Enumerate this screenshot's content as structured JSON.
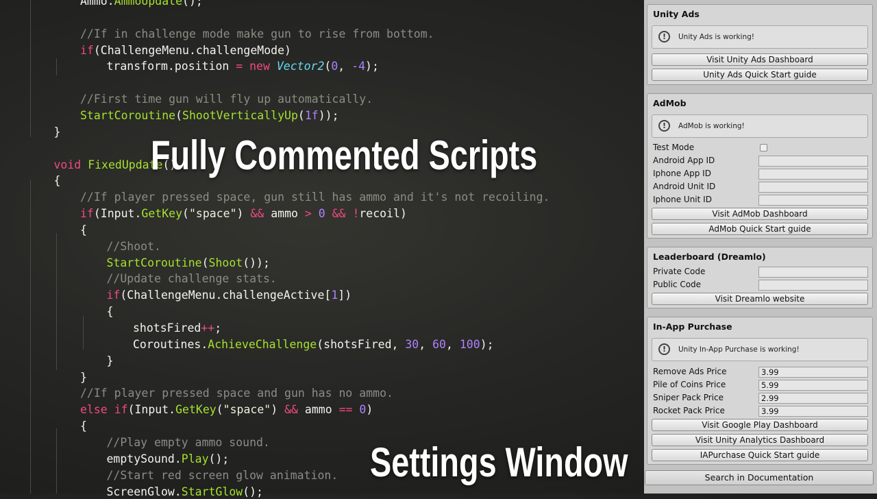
{
  "code_lines": [
    [
      [
        "",
        "Ammo."
      ],
      [
        "t-fn",
        "AmmoUpdate"
      ],
      [
        "",
        "();"
      ]
    ],
    [],
    [
      [
        "t-com",
        "//If in challenge mode make gun to rise from bottom."
      ]
    ],
    [
      [
        "t-kw",
        "if"
      ],
      [
        "",
        "(ChallengeMenu.challengeMode)"
      ]
    ],
    [
      [
        "",
        "transform.position "
      ],
      [
        "t-op",
        "="
      ],
      [
        "",
        " "
      ],
      [
        "t-kw",
        "new"
      ],
      [
        "",
        " "
      ],
      [
        "t-type",
        "Vector2"
      ],
      [
        "",
        "("
      ],
      [
        "t-num",
        "0"
      ],
      [
        "",
        ", "
      ],
      [
        "t-num",
        "-4"
      ],
      [
        "",
        ");"
      ]
    ],
    [],
    [
      [
        "t-com",
        "//First time gun will fly up automatically."
      ]
    ],
    [
      [
        "t-fn",
        "StartCoroutine"
      ],
      [
        "",
        "("
      ],
      [
        "t-fn",
        "ShootVerticallyUp"
      ],
      [
        "",
        "("
      ],
      [
        "t-num",
        "1f"
      ],
      [
        "",
        "));"
      ]
    ],
    [
      [
        "",
        "}"
      ]
    ],
    [],
    [
      [
        "t-kw",
        "void"
      ],
      [
        "",
        " "
      ],
      [
        "t-fn",
        "FixedUpdate"
      ],
      [
        "",
        "()"
      ]
    ],
    [
      [
        "",
        "{"
      ]
    ],
    [
      [
        "t-com",
        "//If player pressed space, gun still has ammo and it's not recoiling."
      ]
    ],
    [
      [
        "t-kw",
        "if"
      ],
      [
        "",
        "(Input."
      ],
      [
        "t-fn",
        "GetKey"
      ],
      [
        "",
        "("
      ],
      [
        "t-str",
        "\"space\""
      ],
      [
        "",
        ") "
      ],
      [
        "t-op",
        "&&"
      ],
      [
        "",
        " ammo "
      ],
      [
        "t-op",
        ">"
      ],
      [
        "",
        " "
      ],
      [
        "t-num",
        "0"
      ],
      [
        "",
        " "
      ],
      [
        "t-op",
        "&&"
      ],
      [
        "",
        " "
      ],
      [
        "t-op",
        "!"
      ],
      [
        "",
        "recoil)"
      ]
    ],
    [
      [
        "",
        "{"
      ]
    ],
    [
      [
        "t-com",
        "//Shoot."
      ]
    ],
    [
      [
        "t-fn",
        "StartCoroutine"
      ],
      [
        "",
        "("
      ],
      [
        "t-fn",
        "Shoot"
      ],
      [
        "",
        "());"
      ]
    ],
    [
      [
        "t-com",
        "//Update challenge stats."
      ]
    ],
    [
      [
        "t-kw",
        "if"
      ],
      [
        "",
        "(ChallengeMenu.challengeActive["
      ],
      [
        "t-num",
        "1"
      ],
      [
        "",
        "])"
      ]
    ],
    [
      [
        "",
        "{"
      ]
    ],
    [
      [
        "",
        "shotsFired"
      ],
      [
        "t-op",
        "++"
      ],
      [
        "",
        ";"
      ]
    ],
    [
      [
        "",
        "Coroutines."
      ],
      [
        "t-fn",
        "AchieveChallenge"
      ],
      [
        "",
        "(shotsFired, "
      ],
      [
        "t-num",
        "30"
      ],
      [
        "",
        ", "
      ],
      [
        "t-num",
        "60"
      ],
      [
        "",
        ", "
      ],
      [
        "t-num",
        "100"
      ],
      [
        "",
        ");"
      ]
    ],
    [
      [
        "",
        "}"
      ]
    ],
    [
      [
        "",
        "}"
      ]
    ],
    [
      [
        "t-com",
        "//If player pressed space and gun has no ammo."
      ]
    ],
    [
      [
        "t-kw",
        "else"
      ],
      [
        "",
        " "
      ],
      [
        "t-kw",
        "if"
      ],
      [
        "",
        "(Input."
      ],
      [
        "t-fn",
        "GetKey"
      ],
      [
        "",
        "("
      ],
      [
        "t-str",
        "\"space\""
      ],
      [
        "",
        ") "
      ],
      [
        "t-op",
        "&&"
      ],
      [
        "",
        " ammo "
      ],
      [
        "t-op",
        "=="
      ],
      [
        "",
        " "
      ],
      [
        "t-num",
        "0"
      ],
      [
        "",
        ")"
      ]
    ],
    [
      [
        "",
        "{"
      ]
    ],
    [
      [
        "t-com",
        "//Play empty ammo sound."
      ]
    ],
    [
      [
        "",
        "emptySound."
      ],
      [
        "t-fn",
        "Play"
      ],
      [
        "",
        "();"
      ]
    ],
    [
      [
        "t-com",
        "//Start red screen glow animation."
      ]
    ],
    [
      [
        "",
        "ScreenGlow."
      ],
      [
        "t-fn",
        "StartGlow"
      ],
      [
        "",
        "();"
      ]
    ]
  ],
  "titles": {
    "main": "Fully Commented Scripts",
    "sub": "Settings Window"
  },
  "unity_ads": {
    "title": "Unity Ads",
    "help": "Unity Ads is working!",
    "dashboard_button": "Visit Unity Ads Dashboard",
    "guide_button": "Unity Ads Quick Start guide"
  },
  "admob": {
    "title": "AdMob",
    "help": "AdMob is working!",
    "test_mode_label": "Test Mode",
    "test_mode_checked": false,
    "fields": [
      {
        "label": "Android App ID",
        "value": ""
      },
      {
        "label": "Iphone App ID",
        "value": ""
      },
      {
        "label": "Android Unit ID",
        "value": ""
      },
      {
        "label": "Iphone Unit ID",
        "value": ""
      }
    ],
    "dashboard_button": "Visit AdMob Dashboard",
    "guide_button": "AdMob Quick Start guide"
  },
  "leaderboard": {
    "title": "Leaderboard (Dreamlo)",
    "fields": [
      {
        "label": "Private Code",
        "value": ""
      },
      {
        "label": "Public Code",
        "value": ""
      }
    ],
    "website_button": "Visit Dreamlo website"
  },
  "iap": {
    "title": "In-App Purchase",
    "help": "Unity In-App Purchase is working!",
    "fields": [
      {
        "label": "Remove Ads Price",
        "value": "3.99"
      },
      {
        "label": "Pile of Coins Price",
        "value": "5.99"
      },
      {
        "label": "Sniper Pack Price",
        "value": "2.99"
      },
      {
        "label": "Rocket Pack Price",
        "value": "3.99"
      }
    ],
    "play_button": "Visit Google Play Dashboard",
    "analytics_button": "Visit Unity Analytics Dashboard",
    "guide_button": "IAPurchase Quick Start guide"
  },
  "search_button": "Search in Documentation",
  "colors": {
    "comment": "#8d8d86",
    "keyword": "#f04a83",
    "function": "#a6e22e",
    "number": "#ae81ff",
    "type": "#66d9ef",
    "panel_bg": "#c2c2c2"
  }
}
